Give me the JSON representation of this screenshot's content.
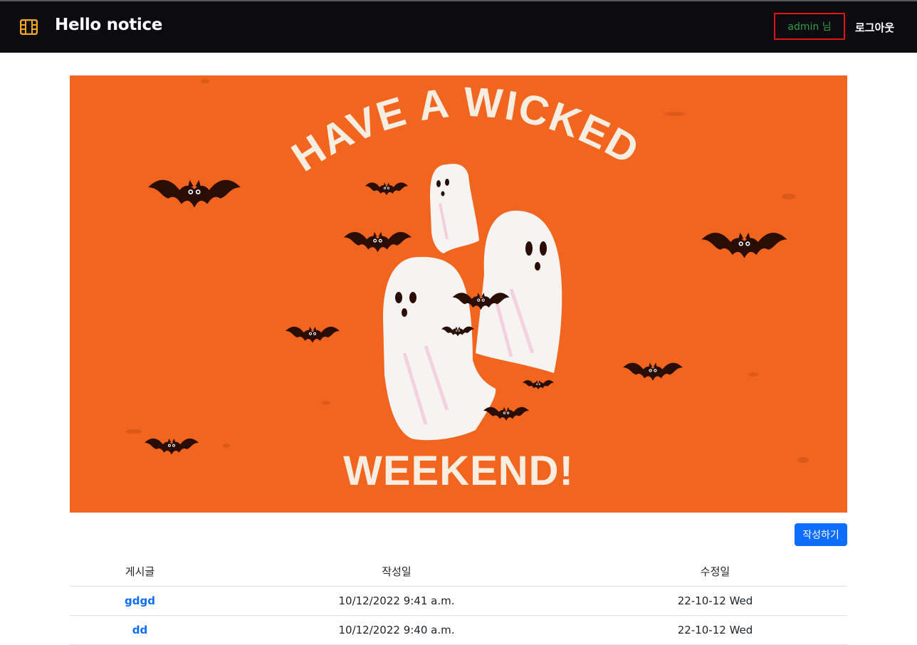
{
  "navbar": {
    "brand_title": "Hello notice",
    "brand_icon": "film-icon",
    "user_label": "admin 님",
    "logout_label": "로그아웃",
    "colors": {
      "background": "#0b0b10",
      "brand_icon": "#f5a623",
      "user": "#2e9e46",
      "highlight_border": "#e01414"
    }
  },
  "banner": {
    "line1": "HAVE A WICKED",
    "line2": "WEEKEND!",
    "colors": {
      "background": "#f2651e",
      "text": "#f7ede0",
      "ghost": "#f6f4f2",
      "bat": "#2a0e06"
    }
  },
  "actions": {
    "write_label": "작성하기"
  },
  "table": {
    "headers": {
      "post": "게시글",
      "created": "작성일",
      "modified": "수정일"
    },
    "rows": [
      {
        "post": "gdgd",
        "created": "10/12/2022 9:41 a.m.",
        "modified": "22-10-12 Wed"
      },
      {
        "post": "dd",
        "created": "10/12/2022 9:40 a.m.",
        "modified": "22-10-12 Wed"
      }
    ]
  }
}
